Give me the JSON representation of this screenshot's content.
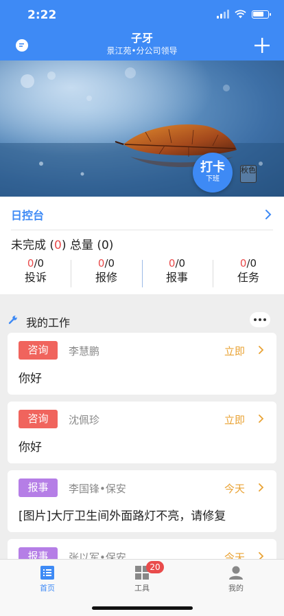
{
  "status_bar": {
    "time": "2:22"
  },
  "header": {
    "title": "子牙",
    "subtitle": "景江苑•分公司领导"
  },
  "banner": {
    "clock_label": "打卡",
    "clock_sublabel": "下班",
    "seal_text": "秋色"
  },
  "dashboard": {
    "title": "日控台",
    "summary": {
      "incomplete_label": "未完成",
      "incomplete_count": "0",
      "total_label": "总量",
      "total_count": "0"
    },
    "stats": [
      {
        "done": "0",
        "total": "/0",
        "label": "投诉"
      },
      {
        "done": "0",
        "total": "/0",
        "label": "报修"
      },
      {
        "done": "0",
        "total": "/0",
        "label": "报事"
      },
      {
        "done": "0",
        "total": "/0",
        "label": "任务"
      }
    ]
  },
  "work": {
    "title": "我的工作",
    "items": [
      {
        "tag": "咨询",
        "person": "李慧鹏",
        "when": "立即",
        "content": "你好"
      },
      {
        "tag": "咨询",
        "person": "沈佩珍",
        "when": "立即",
        "content": "你好"
      },
      {
        "tag": "报事",
        "person": "李国锋•保安",
        "when": "今天",
        "content": "[图片]大厅卫生间外面路灯不亮，请修复"
      },
      {
        "tag": "报事",
        "person": "张以军•保安",
        "when": "今天",
        "content": ""
      }
    ]
  },
  "tabbar": {
    "tabs": [
      {
        "label": "首页"
      },
      {
        "label": "工具",
        "badge": "20"
      },
      {
        "label": "我的"
      }
    ]
  },
  "colors": {
    "primary": "#3e8af5",
    "consult_tag": "#f0645d",
    "report_tag": "#b57ee6",
    "time_accent": "#e9a233",
    "alert": "#e94b4b"
  },
  "icons": [
    "chat-icon",
    "plus-icon",
    "chevron-right-icon",
    "wrench-icon",
    "more-icon",
    "home-list-icon",
    "grid-icon",
    "person-icon",
    "signal-icon",
    "wifi-icon",
    "battery-icon"
  ]
}
